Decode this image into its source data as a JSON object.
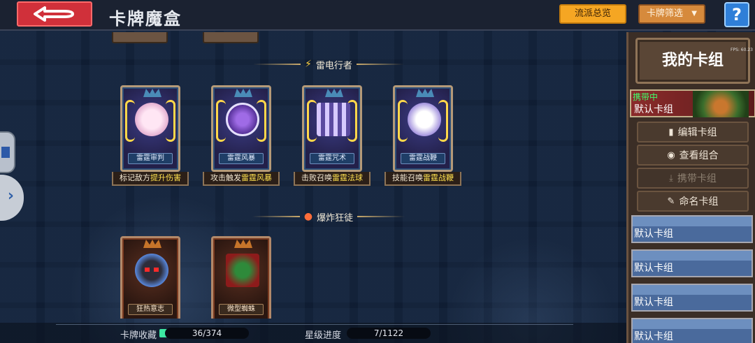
{
  "header": {
    "title": "卡牌魔盒",
    "overview_label": "流派总览",
    "filter_label": "卡牌筛选",
    "help_label": "?"
  },
  "sections": [
    {
      "name": "雷电行者",
      "icon": "lightning-icon",
      "cards": [
        {
          "name": "雷霆审判",
          "desc_pre": "标记敌方",
          "desc_hl": "提升伤害",
          "art": "pink"
        },
        {
          "name": "雷霆风暴",
          "desc_pre": "攻击触发",
          "desc_hl": "雷霆风暴",
          "art": "purple"
        },
        {
          "name": "雷霆咒术",
          "desc_pre": "击败召唤",
          "desc_hl": "雷霆法球",
          "art": "pillars"
        },
        {
          "name": "雷霆战鞭",
          "desc_pre": "技能召唤",
          "desc_hl": "雷霆战鞭",
          "art": "bird"
        }
      ]
    },
    {
      "name": "爆炸狂徒",
      "icon": "bomb-icon",
      "cards": [
        {
          "name": "狂热意志",
          "art": "skull"
        },
        {
          "name": "微型蜘蛛",
          "art": "spider"
        }
      ]
    }
  ],
  "panel": {
    "title": "我的卡组",
    "fps": "FPS: 60.23",
    "current_deck": {
      "status": "携带中",
      "name": "默认卡组"
    },
    "buttons": [
      {
        "label": "编辑卡组",
        "icon": "deck-icon",
        "enabled": true
      },
      {
        "label": "查看组合",
        "icon": "eye-icon",
        "enabled": true
      },
      {
        "label": "携带卡组",
        "icon": "download-icon",
        "enabled": false
      },
      {
        "label": "命名卡组",
        "icon": "pencil-icon",
        "enabled": true
      }
    ],
    "deck_slots": [
      "默认卡组",
      "默认卡组",
      "默认卡组",
      "默认卡组"
    ]
  },
  "status": {
    "collection_label": "卡牌收藏",
    "collection_value": "36/374",
    "star_label": "星级进度",
    "star_value": "7/1122"
  }
}
